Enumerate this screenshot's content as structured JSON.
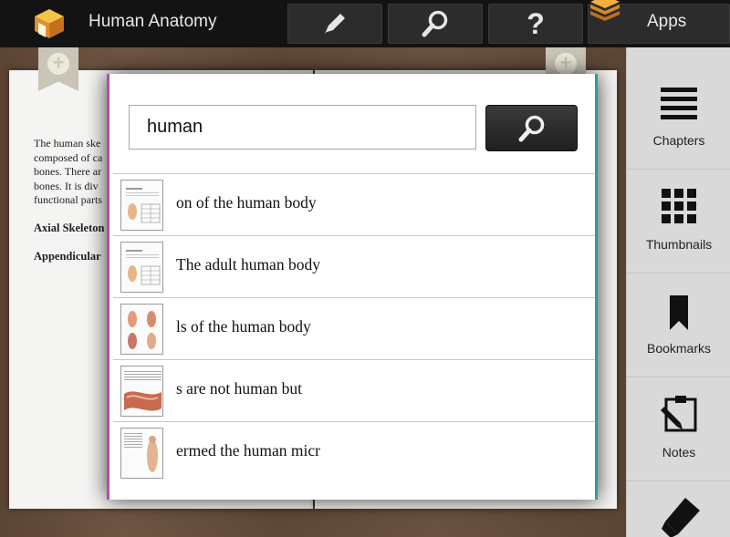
{
  "app": {
    "title": "Human Anatomy",
    "logo_icon": "book-box-icon"
  },
  "toolbar": {
    "edit_icon": "pencil-icon",
    "search_icon": "search-icon",
    "help_icon": "question-icon",
    "apps_label": "Apps",
    "apps_icon": "stack-icon"
  },
  "page": {
    "lines": [
      "The human ske",
      "composed of ca",
      "bones. There ar",
      "bones.  It is div",
      "functional parts"
    ],
    "heading1": "Axial Skeleton",
    "heading2": "Appendicular"
  },
  "sidebar": {
    "items": [
      {
        "label": "Chapters",
        "icon": "list-icon"
      },
      {
        "label": "Thumbnails",
        "icon": "grid-icon"
      },
      {
        "label": "Bookmarks",
        "icon": "bookmark-icon"
      },
      {
        "label": "Notes",
        "icon": "notes-icon"
      },
      {
        "label": "",
        "icon": "highlighter-icon"
      }
    ]
  },
  "search": {
    "query": "human",
    "button_icon": "search-icon",
    "results": [
      {
        "text": "on of the human body"
      },
      {
        "text": "The adult human body"
      },
      {
        "text": "ls of the human body"
      },
      {
        "text": "s are not human but"
      },
      {
        "text": "ermed the human micr"
      }
    ]
  },
  "colors": {
    "topbar": "#131313",
    "sidebar": "#d9d9d9",
    "modal_left_edge": "#b04fb0",
    "modal_right_edge": "#2f9ba6"
  }
}
